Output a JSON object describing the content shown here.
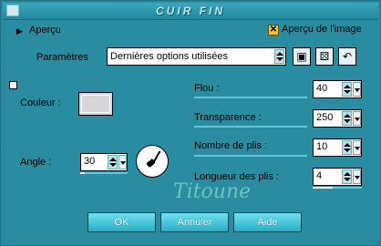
{
  "window": {
    "title": "CUIR FIN"
  },
  "apercu": {
    "arrow": "▶",
    "label": "Aperçu"
  },
  "preview_image": {
    "label": "Aperçu de l'image",
    "checked": true,
    "mark": "✕"
  },
  "parametres": {
    "label": "Paramètres",
    "value": "Dernières options utilisées"
  },
  "couleur": {
    "label": "Couleur :",
    "value": "#d6d6d6"
  },
  "angle": {
    "label": "Angle :",
    "value": "30"
  },
  "flou": {
    "label": "Flou :",
    "value": "40"
  },
  "transparence": {
    "label": "Transparence :",
    "value": "250"
  },
  "nombre_plis": {
    "label": "Nombre de plis :",
    "value": "10"
  },
  "longueur_plis": {
    "label": "Longueur des plis :",
    "value": "4"
  },
  "watermark": "Titoune",
  "buttons": {
    "ok": "OK",
    "annuler": "Annuler",
    "aide": "Aide"
  },
  "colors": {
    "dialog_bg": "#2a8ca0",
    "button_top": "#6fe0f0",
    "button_bottom": "#28aec6",
    "check_bg": "#f1c232"
  }
}
